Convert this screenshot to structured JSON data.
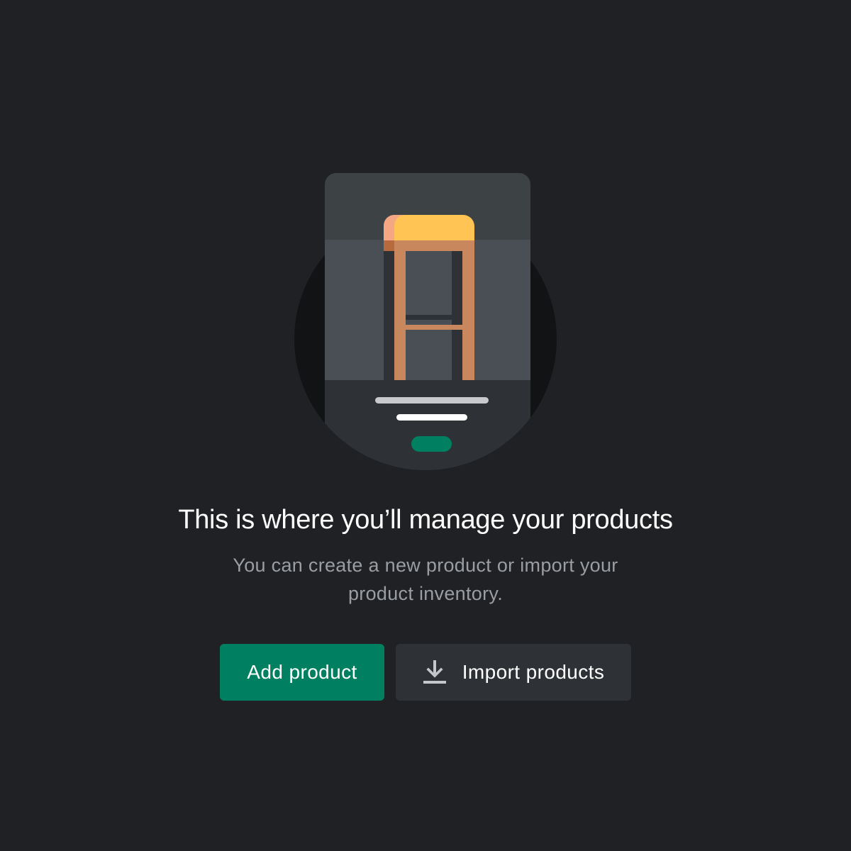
{
  "empty_state": {
    "title": "This is where you’ll manage your products",
    "description": "You can create a new product or import your product inventory."
  },
  "actions": {
    "add_product_label": "Add product",
    "import_products_label": "Import products",
    "import_icon": "download-icon"
  },
  "colors": {
    "background": "#1f2124",
    "primary_button": "#008060",
    "secondary_button": "#2e3135",
    "stool_seat": "#ffc453",
    "stool_legs": "#c9875e"
  }
}
